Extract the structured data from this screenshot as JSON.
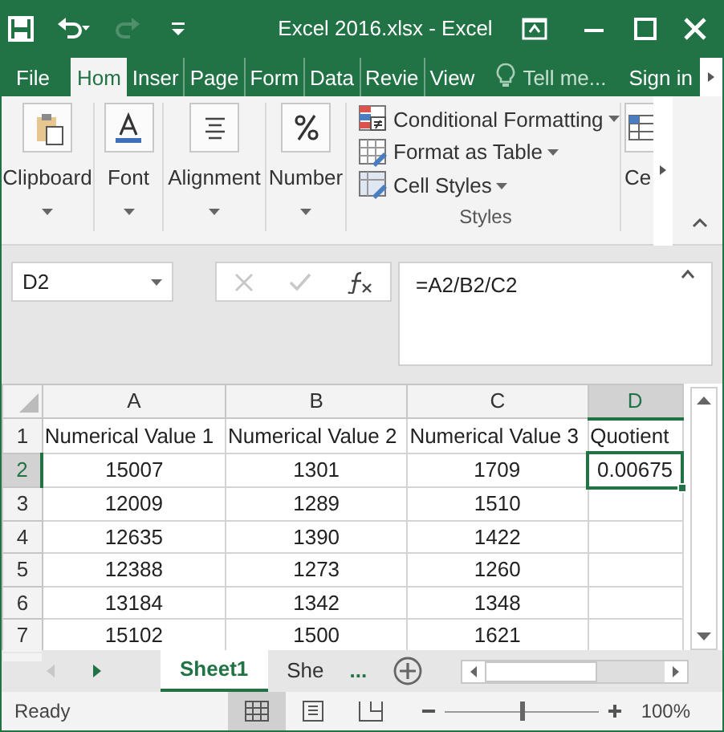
{
  "window": {
    "title": "Excel 2016.xlsx - Excel"
  },
  "ribbon_tabs": [
    {
      "label": "File",
      "selected": false
    },
    {
      "label": "Hom",
      "selected": true
    },
    {
      "label": "Inser",
      "selected": false
    },
    {
      "label": "Page",
      "selected": false
    },
    {
      "label": "Form",
      "selected": false
    },
    {
      "label": "Data",
      "selected": false
    },
    {
      "label": "Revie",
      "selected": false
    },
    {
      "label": "View",
      "selected": false
    }
  ],
  "tell_me": "Tell me...",
  "sign_in": "Sign in",
  "ribbon_groups": [
    {
      "kind": "button",
      "label": "Clipboard"
    },
    {
      "kind": "button",
      "label": "Font"
    },
    {
      "kind": "button",
      "label": "Alignment"
    },
    {
      "kind": "button",
      "label": "Number"
    },
    {
      "kind": "commands",
      "label": "Styles",
      "commands": [
        "Conditional Formatting",
        "Format as Table",
        "Cell Styles"
      ]
    },
    {
      "kind": "button",
      "label": "Ce"
    }
  ],
  "name_box": "D2",
  "formula": "=A2/B2/C2",
  "grid": {
    "columns": [
      {
        "label": "A",
        "selected": false
      },
      {
        "label": "B",
        "selected": false
      },
      {
        "label": "C",
        "selected": false
      },
      {
        "label": "D",
        "selected": true
      }
    ],
    "rows": [
      {
        "header": "1",
        "selected": false,
        "kind": "text",
        "cells": [
          {
            "text": "Numerical Value 1",
            "selected": false
          },
          {
            "text": "Numerical Value 2",
            "selected": false
          },
          {
            "text": "Numerical Value 3",
            "selected": false
          },
          {
            "text": "Quotient",
            "selected": false
          }
        ]
      },
      {
        "header": "2",
        "selected": true,
        "kind": "number",
        "cells": [
          {
            "text": "15007",
            "selected": false
          },
          {
            "text": "1301",
            "selected": false
          },
          {
            "text": "1709",
            "selected": false
          },
          {
            "text": "0.00675",
            "selected": true
          }
        ]
      },
      {
        "header": "3",
        "selected": false,
        "kind": "number",
        "cells": [
          {
            "text": "12009",
            "selected": false
          },
          {
            "text": "1289",
            "selected": false
          },
          {
            "text": "1510",
            "selected": false
          }
        ]
      },
      {
        "header": "4",
        "selected": false,
        "kind": "number",
        "cells": [
          {
            "text": "12635",
            "selected": false
          },
          {
            "text": "1390",
            "selected": false
          },
          {
            "text": "1422",
            "selected": false
          }
        ]
      },
      {
        "header": "5",
        "selected": false,
        "kind": "number",
        "cells": [
          {
            "text": "12388",
            "selected": false
          },
          {
            "text": "1273",
            "selected": false
          },
          {
            "text": "1260",
            "selected": false
          }
        ]
      },
      {
        "header": "6",
        "selected": false,
        "kind": "number",
        "cells": [
          {
            "text": "13184",
            "selected": false
          },
          {
            "text": "1342",
            "selected": false
          },
          {
            "text": "1348",
            "selected": false
          }
        ]
      },
      {
        "header": "7",
        "selected": false,
        "kind": "number",
        "cells": [
          {
            "text": "15102",
            "selected": false
          },
          {
            "text": "1500",
            "selected": false
          },
          {
            "text": "1621",
            "selected": false
          }
        ]
      }
    ]
  },
  "sheets": [
    {
      "label": "Sheet1",
      "selected": true
    },
    {
      "label": "She",
      "selected": false
    }
  ],
  "more_sheets": "...",
  "status": "Ready",
  "views": [
    {
      "kind": "normal",
      "selected": true
    },
    {
      "kind": "layout",
      "selected": false
    },
    {
      "kind": "break",
      "selected": false
    }
  ],
  "zoom": {
    "level": 0.5,
    "reading": "100%"
  }
}
